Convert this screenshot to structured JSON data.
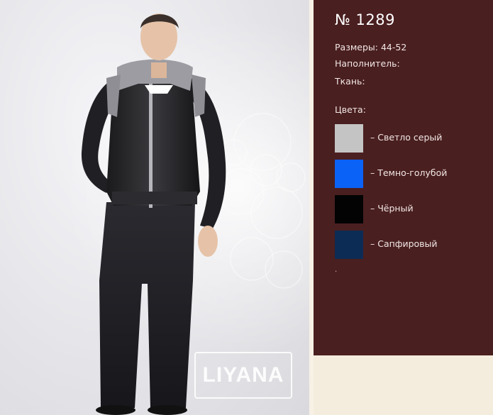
{
  "product": {
    "number": "№ 1289",
    "sizes": "Размеры: 44-52",
    "filler": "Наполнитель:",
    "fabric": "Ткань:",
    "colors_heading": "Цвета:",
    "colors": [
      {
        "name": "– Светло серый",
        "hex": "#c4c4c4"
      },
      {
        "name": "– Темно-голубой",
        "hex": "#0a62f6"
      },
      {
        "name": "– Чёрный",
        "hex": "#030303"
      },
      {
        "name": "– Сапфировый",
        "hex": "#0d2c55"
      }
    ],
    "trailing_mark": "."
  },
  "photo": {
    "logo_text": "LIYANA",
    "description_icon": "model-photo"
  },
  "theme": {
    "panel_bg": "#4a1f20",
    "page_bg": "#f4ecdd"
  }
}
